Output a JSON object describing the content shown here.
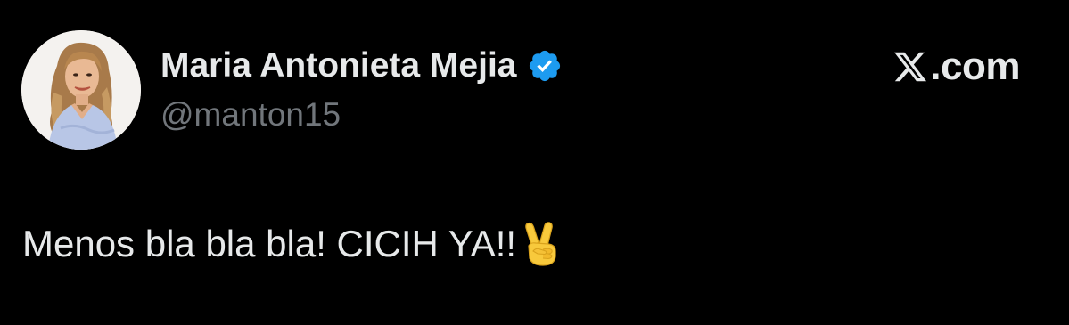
{
  "post": {
    "author": {
      "display_name": "Maria Antonieta Mejia",
      "handle": "@manton15",
      "verified_icon": "verified-badge-icon"
    },
    "brand": {
      "icon": "x-logo-icon",
      "text": ".com"
    },
    "text": "Menos bla bla bla! CICIH YA!!",
    "emoji_icon": "victory-hand-emoji"
  },
  "colors": {
    "background": "#000000",
    "primary_text": "#e7e9ea",
    "secondary_text": "#71767b",
    "verified_blue": "#1d9bf0"
  }
}
